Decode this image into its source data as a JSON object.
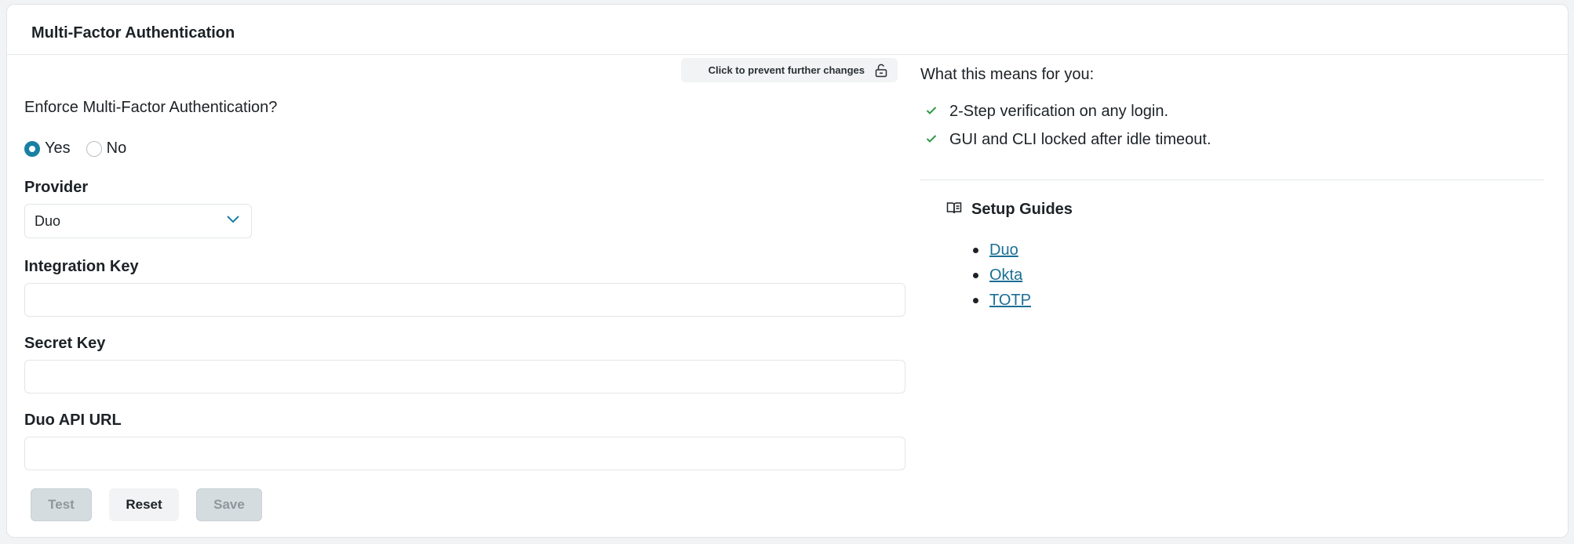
{
  "header": {
    "title": "Multi-Factor Authentication"
  },
  "lock": {
    "label": "Click to prevent further changes",
    "icon": "unlock-icon"
  },
  "form": {
    "question": "Enforce Multi-Factor Authentication?",
    "radio": {
      "options": [
        "Yes",
        "No"
      ],
      "selected": "Yes"
    },
    "provider": {
      "label": "Provider",
      "value": "Duo"
    },
    "integration_key": {
      "label": "Integration Key",
      "value": ""
    },
    "secret_key": {
      "label": "Secret Key",
      "value": ""
    },
    "api_url": {
      "label": "Duo API URL",
      "value": ""
    }
  },
  "buttons": {
    "test": "Test",
    "reset": "Reset",
    "save": "Save"
  },
  "info": {
    "title": "What this means for you:",
    "items": [
      "2-Step verification on any login.",
      "GUI and CLI locked after idle timeout."
    ]
  },
  "guides": {
    "title": "Setup Guides",
    "links": [
      "Duo",
      "Okta",
      "TOTP"
    ]
  },
  "colors": {
    "accent": "#1a7fa3",
    "check": "#2e9a4a",
    "link": "#1a6f94"
  }
}
